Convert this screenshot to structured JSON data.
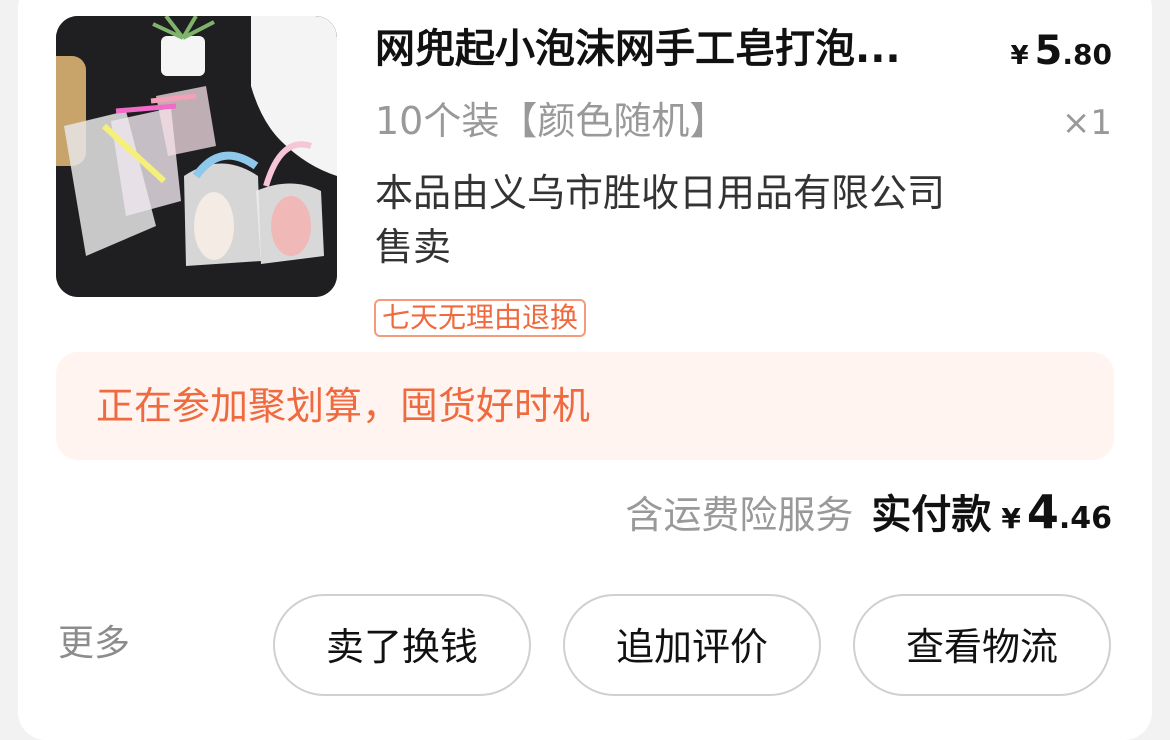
{
  "order": {
    "product": {
      "title": "网兜起小泡沫网手工皂打泡...",
      "variant": "10个装【颜色随机】",
      "seller_note": "本品由义乌市胜收日用品有限公司售卖",
      "badge": "七天无理由退换",
      "price_symbol": "¥",
      "price_int": "5",
      "price_dec": ".80",
      "quantity": "×1",
      "image_icon": "product-thumbnail-soap-net-bags"
    },
    "promo": {
      "text": "正在参加聚划算，囤货好时机"
    },
    "payment": {
      "insurance_note": "含运费险服务",
      "label": "实付款",
      "symbol": "¥",
      "amount_int": "4",
      "amount_dec": ".46"
    },
    "actions": {
      "more": "更多",
      "sell": "卖了换钱",
      "review": "追加评价",
      "logistics": "查看物流"
    }
  },
  "colors": {
    "accent": "#ef6a3e",
    "promo_bg": "#fff4f0",
    "muted": "#999999"
  }
}
